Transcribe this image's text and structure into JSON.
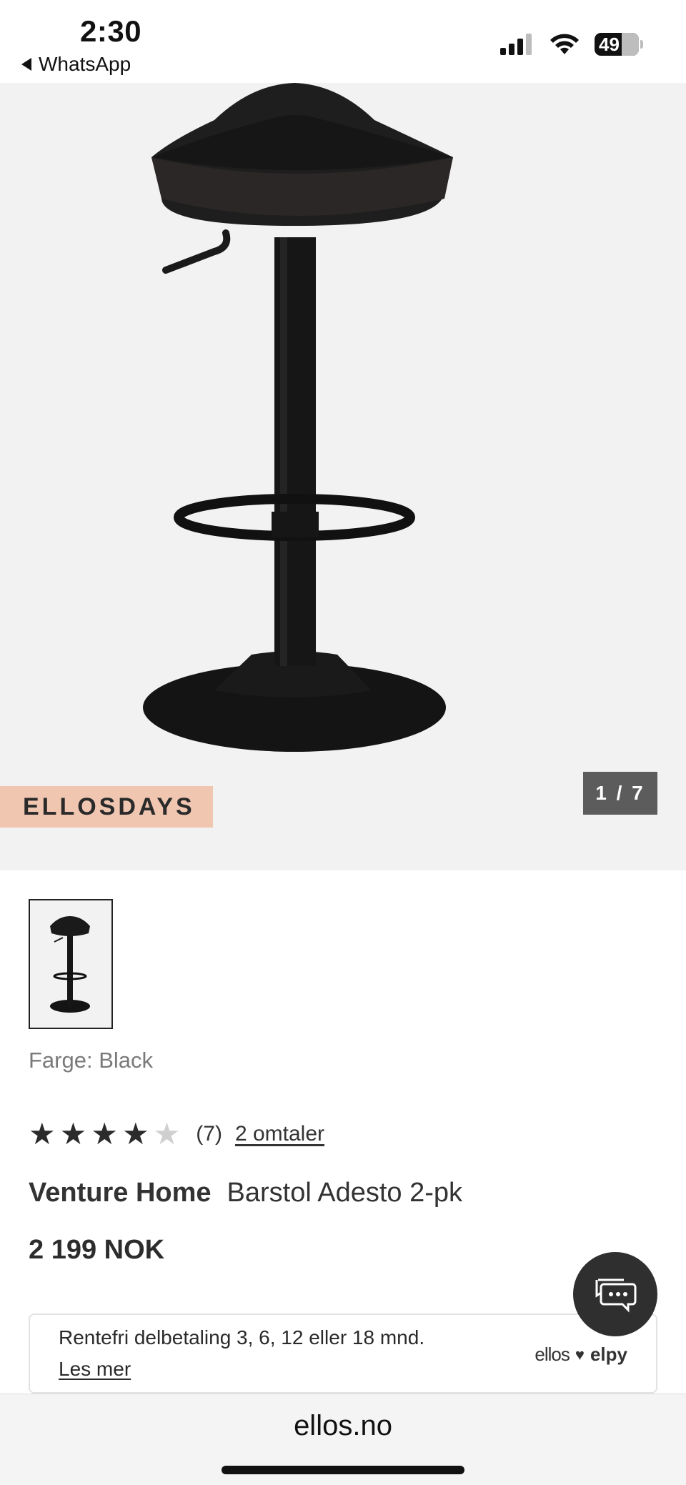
{
  "status_bar": {
    "time": "2:30",
    "back_app": "WhatsApp",
    "battery": "49"
  },
  "gallery": {
    "promo_badge": "ELLOSDAYS",
    "counter": "1 / 7"
  },
  "product": {
    "color_label": "Farge: Black",
    "rating": {
      "value": 4,
      "max": 5,
      "count_label": "(7)",
      "reviews_link": "2 omtaler"
    },
    "brand": "Venture Home",
    "name": "Barstol Adesto 2-pk",
    "price": "2 199 NOK"
  },
  "finance": {
    "text": "Rentefri delbetaling 3, 6, 12 eller 18 mnd.",
    "link": "Les mer",
    "partner_left": "ellos",
    "partner_right": "elpy"
  },
  "browser": {
    "url": "ellos.no"
  },
  "icons": {
    "chat": "chat-bubbles-icon",
    "back": "back-arrow-icon",
    "signal": "cellular-signal-icon",
    "wifi": "wifi-icon",
    "battery": "battery-icon"
  }
}
